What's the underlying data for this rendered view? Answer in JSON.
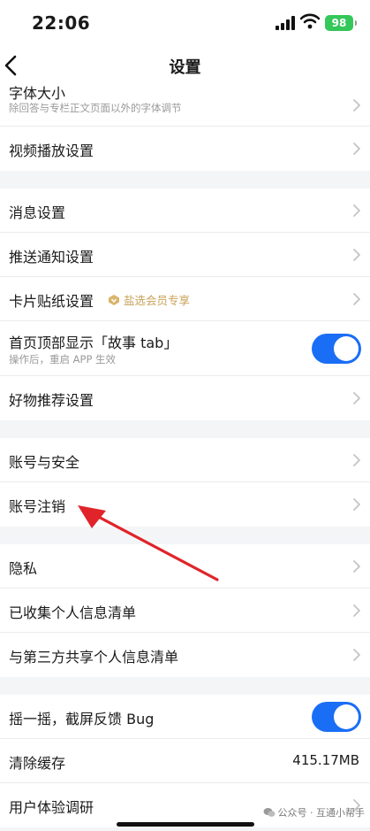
{
  "status_bar": {
    "time": "22:06",
    "battery": "98"
  },
  "nav": {
    "title": "设置"
  },
  "groups": [
    {
      "rows": [
        {
          "label": "字体大小",
          "sub": "除回答与专栏正文页面以外的字体调节"
        },
        {
          "label": "视频播放设置"
        }
      ]
    },
    {
      "rows": [
        {
          "label": "消息设置"
        },
        {
          "label": "推送通知设置"
        },
        {
          "label": "卡片贴纸设置",
          "badge": "盐选会员专享"
        },
        {
          "label": "首页顶部显示「故事 tab」",
          "sub": "操作后，重启 APP 生效",
          "toggle": true
        },
        {
          "label": "好物推荐设置"
        }
      ]
    },
    {
      "rows": [
        {
          "label": "账号与安全"
        },
        {
          "label": "账号注销"
        }
      ]
    },
    {
      "rows": [
        {
          "label": "隐私"
        },
        {
          "label": "已收集个人信息清单"
        },
        {
          "label": "与第三方共享个人信息清单"
        }
      ]
    },
    {
      "rows": [
        {
          "label": "摇一摇，截屏反馈 Bug",
          "toggle": true
        },
        {
          "label": "清除缓存",
          "value": "415.17MB"
        },
        {
          "label": "用户体验调研"
        }
      ]
    }
  ],
  "watermark": {
    "text": "公众号 · 互通小帮手"
  },
  "colors": {
    "accent": "#1a6ef5",
    "vip_gold": "#c9a35a",
    "annotation": "#e0242a",
    "battery_green": "#34c759"
  }
}
